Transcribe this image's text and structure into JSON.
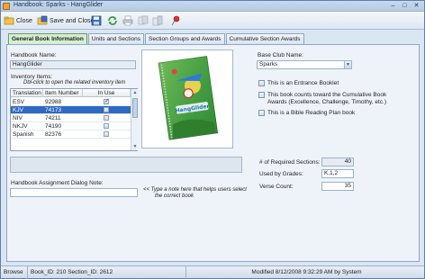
{
  "window": {
    "title": "Handbook: Sparks - HangGlider",
    "minimize": "–",
    "maximize": "□",
    "close": "✕"
  },
  "toolbar": {
    "close_label": "Close",
    "save_close_label": "Save and Close"
  },
  "tabs": [
    {
      "label": "General Book Information",
      "active": true
    },
    {
      "label": "Units and Sections",
      "active": false
    },
    {
      "label": "Section Groups and Awards",
      "active": false
    },
    {
      "label": "Cumulative Section Awards",
      "active": false
    }
  ],
  "general": {
    "handbook_name_label": "Handbook Name:",
    "handbook_name_value": "HangGlider",
    "inventory_label": "Inventory Items:",
    "inventory_hint": "Dbl-click to open the related inventory item",
    "inventory_columns": [
      "Translation",
      "Item Number",
      "In Use"
    ],
    "inventory_rows": [
      {
        "translation": "ESV",
        "item_number": "92988",
        "in_use": true,
        "selected": false
      },
      {
        "translation": "KJV",
        "item_number": "74173",
        "in_use": false,
        "selected": true
      },
      {
        "translation": "NIV",
        "item_number": "74211",
        "in_use": false,
        "selected": false
      },
      {
        "translation": "NKJV",
        "item_number": "74190",
        "in_use": false,
        "selected": false
      },
      {
        "translation": "Spanish",
        "item_number": "82376",
        "in_use": false,
        "selected": false
      }
    ],
    "dialog_note_label": "Handbook Assignment Dialog Note:",
    "dialog_note_value": "",
    "dialog_note_hint_line1": "<< Type a note here that helps users select",
    "dialog_note_hint_line2": "the correct book",
    "cover_image_text": "HangGlider",
    "base_club_label": "Base Club Name:",
    "base_club_value": "Sparks",
    "checkbox_entrance": "This is an Entrance Booklet",
    "checkbox_cumulative": "This book counts toward the Cumulative Book Awards (Excellence, Challenge, Timothy, etc.)",
    "checkbox_cumulative_line1": "This book counts toward the Cumulative Book",
    "checkbox_cumulative_line2": "Awards (Excellence, Challenge, Timothy, etc.)",
    "checkbox_bible_plan": "This is a Bible Reading Plan book",
    "required_sections_label": "# of Required Sections:",
    "required_sections_value": "40",
    "used_by_grades_label": "Used by Grades:",
    "used_by_grades_value": "K,1,2",
    "verse_count_label": "Verse Count:",
    "verse_count_value": "35"
  },
  "status": {
    "mode": "Browse",
    "ids": "Book_ID: 210  Section_ID: 2612",
    "modified": "Modified 8/12/2008 9:32:29 AM by System"
  },
  "colors": {
    "active_tab": "#d4f0d0",
    "selection": "#2f69c4",
    "chrome": "#dbe6f3"
  }
}
